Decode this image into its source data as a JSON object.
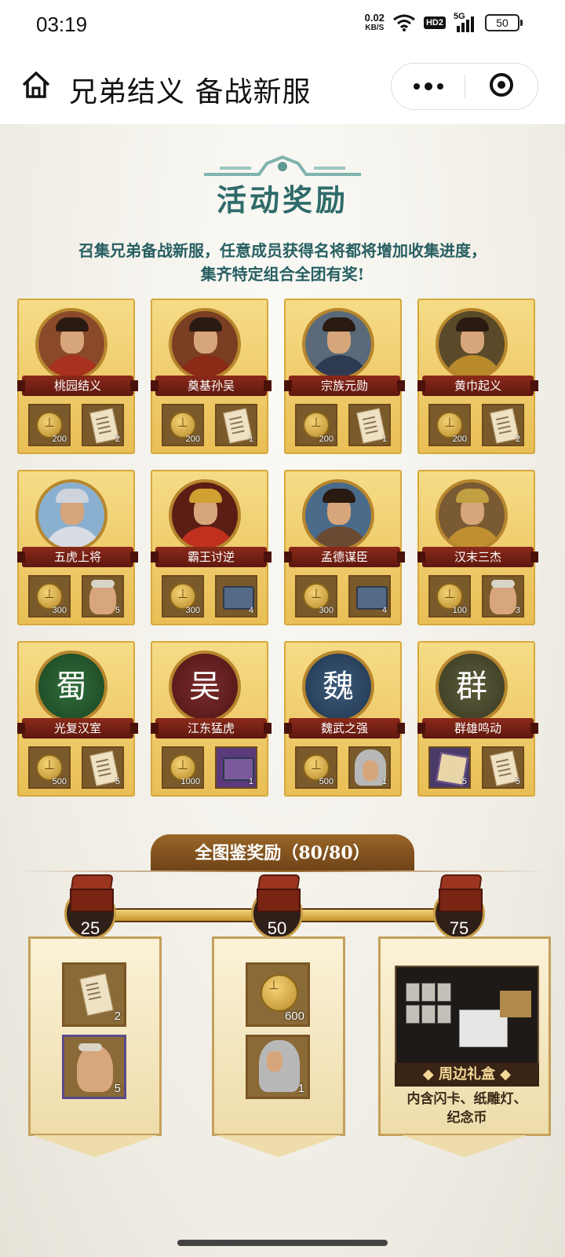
{
  "status": {
    "time": "03:19",
    "net_speed": "0.02",
    "net_unit": "KB/S",
    "hd": "HD2",
    "signal": "5G",
    "battery": "50"
  },
  "nav": {
    "title": "兄弟结义 备战新服"
  },
  "section": {
    "title": "活动奖励",
    "desc_line1": "召集兄弟备战新服，任意成员获得名将都将增加收集进度，",
    "desc_line2": "集齐特定组合全团有奖!"
  },
  "cards": [
    {
      "name": "桃园结义",
      "icon": "general-portrait",
      "item1": {
        "icon": "coin-icon",
        "qty": "200"
      },
      "item2": {
        "icon": "scroll-icon",
        "qty": "2"
      }
    },
    {
      "name": "奠基孙吴",
      "icon": "general-portrait",
      "item1": {
        "icon": "coin-icon",
        "qty": "200"
      },
      "item2": {
        "icon": "scroll-icon",
        "qty": "1"
      }
    },
    {
      "name": "宗族元勋",
      "icon": "general-portrait",
      "item1": {
        "icon": "coin-icon",
        "qty": "200"
      },
      "item2": {
        "icon": "scroll-icon",
        "qty": "1"
      }
    },
    {
      "name": "黄巾起义",
      "icon": "general-portrait",
      "item1": {
        "icon": "coin-icon",
        "qty": "200"
      },
      "item2": {
        "icon": "scroll-icon",
        "qty": "2"
      }
    },
    {
      "name": "五虎上将",
      "icon": "general-portrait",
      "item1": {
        "icon": "coin-icon",
        "qty": "300"
      },
      "item2": {
        "icon": "soldier-icon",
        "qty": "5"
      }
    },
    {
      "name": "霸王讨逆",
      "icon": "general-portrait",
      "item1": {
        "icon": "coin-icon",
        "qty": "300"
      },
      "item2": {
        "icon": "chest-icon",
        "qty": "4"
      }
    },
    {
      "name": "孟德谋臣",
      "icon": "general-portrait",
      "item1": {
        "icon": "coin-icon",
        "qty": "300"
      },
      "item2": {
        "icon": "chest-icon",
        "qty": "4"
      }
    },
    {
      "name": "汉末三杰",
      "icon": "general-portrait",
      "item1": {
        "icon": "coin-icon",
        "qty": "100"
      },
      "item2": {
        "icon": "soldier-icon",
        "qty": "3"
      }
    },
    {
      "name": "光复汉室",
      "glyph": "蜀",
      "item1": {
        "icon": "coin-icon",
        "qty": "500"
      },
      "item2": {
        "icon": "scroll-icon",
        "qty": "5"
      }
    },
    {
      "name": "江东猛虎",
      "glyph": "吴",
      "item1": {
        "icon": "coin-icon",
        "qty": "1000"
      },
      "item2": {
        "icon": "chest-icon",
        "qty": "1"
      }
    },
    {
      "name": "魏武之强",
      "glyph": "魏",
      "item1": {
        "icon": "coin-icon",
        "qty": "500"
      },
      "item2": {
        "icon": "helmet-soldier-icon",
        "qty": "1"
      }
    },
    {
      "name": "群雄鸣动",
      "glyph": "群",
      "item1": {
        "icon": "book-icon",
        "qty": "5"
      },
      "item2": {
        "icon": "scroll-icon",
        "qty": "5"
      }
    }
  ],
  "collection": {
    "title": "全图鉴奖励（80/80）",
    "milestones": [
      "25",
      "50",
      "75"
    ],
    "m1": {
      "slot1_qty": "2",
      "slot2_qty": "5"
    },
    "m2": {
      "slot1_qty": "600",
      "slot2_qty": "1"
    },
    "m3": {
      "gift_label": "◆ 周边礼盒 ◆",
      "desc_line1": "内含闪卡、纸雕灯、",
      "desc_line2": "纪念币"
    }
  },
  "colors": {
    "accent": "#2f6b6a",
    "gold": "#e9be55",
    "ribbon": "#7a2214"
  }
}
